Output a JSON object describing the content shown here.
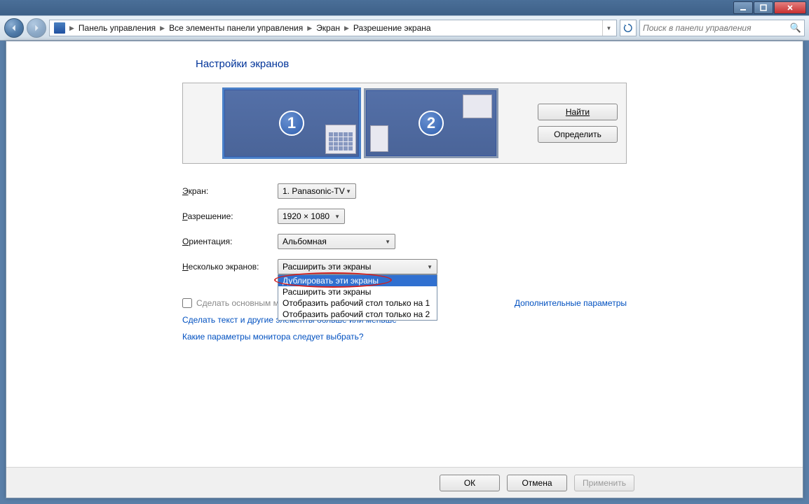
{
  "breadcrumb": {
    "items": [
      "Панель управления",
      "Все элементы панели управления",
      "Экран",
      "Разрешение экрана"
    ]
  },
  "search": {
    "placeholder": "Поиск в панели управления"
  },
  "page_title": "Настройки экранов",
  "side_buttons": {
    "find": "Найти",
    "identify": "Определить"
  },
  "monitors": {
    "m1": "1",
    "m2": "2"
  },
  "form": {
    "screen_label": "Экран:",
    "screen_value": "1. Panasonic-TV",
    "resolution_label": "Разрешение:",
    "resolution_value": "1920 × 1080",
    "orientation_label": "Ориентация:",
    "orientation_value": "Альбомная",
    "multiple_label": "Несколько экранов:",
    "multiple_value": "Расширить эти экраны",
    "multiple_options": [
      "Дублировать эти экраны",
      "Расширить эти экраны",
      "Отобразить рабочий стол только на 1",
      "Отобразить рабочий стол только на 2"
    ]
  },
  "checkbox": {
    "label": "Сделать основным монитором"
  },
  "adv_link": "Дополнительные параметры",
  "links": {
    "l1": "Сделать текст и другие элементы больше или меньше",
    "l2": "Какие параметры монитора следует выбрать?"
  },
  "buttons": {
    "ok": "ОК",
    "cancel": "Отмена",
    "apply": "Применить"
  }
}
